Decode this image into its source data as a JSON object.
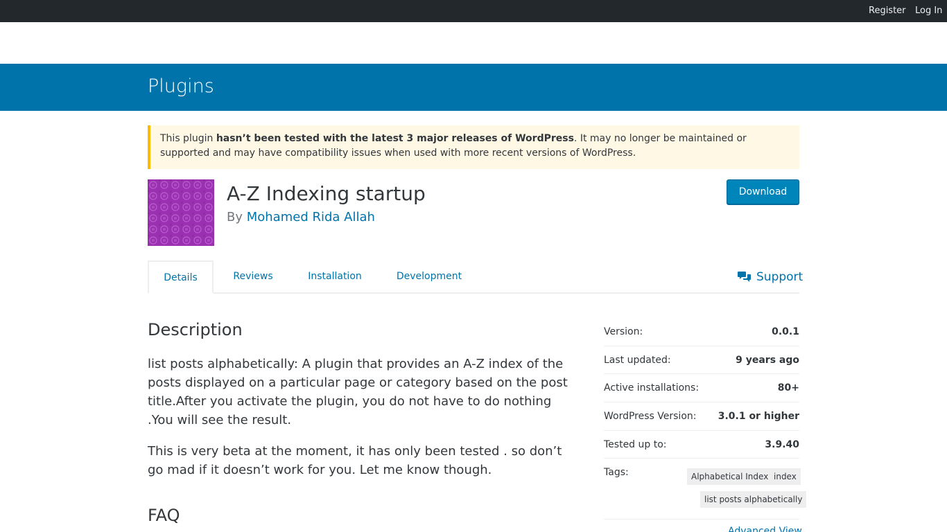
{
  "topbar": {
    "register": "Register",
    "login": "Log In"
  },
  "banner": {
    "title": "Plugins"
  },
  "notice": {
    "prefix": "This plugin ",
    "bold": "hasn’t been tested with the latest 3 major releases of WordPress",
    "suffix": ". It may no longer be maintained or supported and may have compatibility issues when used with more recent versions of WordPress."
  },
  "plugin": {
    "title": "A-Z Indexing startup",
    "by": "By ",
    "author": "Mohamed Rida Allah",
    "download": "Download"
  },
  "tabs": {
    "details": "Details",
    "reviews": "Reviews",
    "installation": "Installation",
    "development": "Development",
    "support": "Support"
  },
  "description": {
    "heading": "Description",
    "p1": "list posts alphabetically: A plugin that provides an A-Z index of the posts displayed on a particular page or category based on the post title.After you activate the plugin, you do not have to do nothing .You will see the result.",
    "p2": "This is very beta at the moment, it has only been tested . so don’t go mad if it doesn’t work for you. Let me know though."
  },
  "faq": {
    "heading": "FAQ"
  },
  "meta": {
    "version_label": "Version:",
    "version": "0.0.1",
    "updated_label": "Last updated:",
    "updated": "9 years ago",
    "installs_label": "Active installations:",
    "installs": "80+",
    "wp_label": "WordPress Version:",
    "wp": "3.0.1 or higher",
    "tested_label": "Tested up to:",
    "tested": "3.9.40",
    "tags_label": "Tags:",
    "tags": [
      "Alphabetical Index",
      "index",
      "list posts alphabetically"
    ],
    "advanced": "Advanced View"
  },
  "colors": {
    "accent": "#0073aa",
    "topbar": "#23282d",
    "notice_border": "#ffb900",
    "icon_bg": "#9b30b0"
  },
  "icons": {
    "support": "speech-bubbles-icon"
  }
}
